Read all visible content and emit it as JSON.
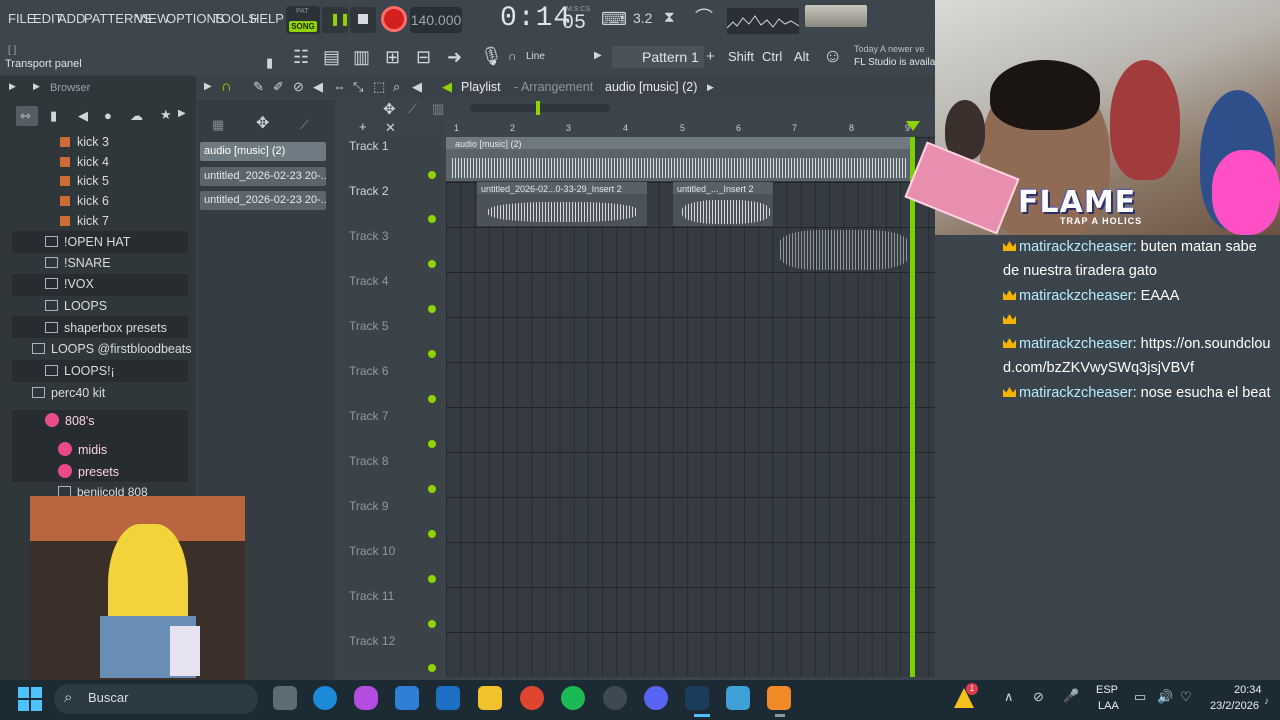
{
  "menu": [
    "FILE",
    "EDIT",
    "ADD",
    "PATTERNS",
    "VIEW",
    "OPTIONS",
    "TOOLS",
    "HELP"
  ],
  "transport": {
    "mode_pat": "PAT",
    "mode_song": "SONG",
    "tempo": "140.000",
    "time_main": "0:14",
    "time_sub": "05",
    "time_unit": "M:S:CS"
  },
  "toolbar": {
    "hint_mark": "[ ]",
    "hint": "Transport panel",
    "line": "Line",
    "pattern": "Pattern 1",
    "shift": "Shift",
    "ctrl": "Ctrl",
    "alt": "Alt",
    "news_1": "Today  A newer ve",
    "news_2": "FL Studio is availa"
  },
  "browser": {
    "title": "Browser",
    "kicks": [
      "kick 3",
      "kick 4",
      "kick 5",
      "kick 6",
      "kick 7"
    ],
    "folders": [
      "!OPEN HAT",
      "!SNARE",
      "!VOX",
      "LOOPS",
      "shaperbox presets"
    ],
    "root_folders": [
      "LOOPS @firstbloodbeats"
    ],
    "loops_sub": "LOOPS!¡",
    "kit": "perc40 kit",
    "pink_folders": [
      "808's",
      "midis",
      "presets"
    ],
    "beniicold": "beniicold 808"
  },
  "channels": [
    "audio [music] (2)",
    "untitled_2026-02-23 20-...",
    "untitled_2026-02-23 20-..."
  ],
  "playlist": {
    "title": "Playlist",
    "sub": "- Arrangement",
    "clip": "audio [music] (2)",
    "ruler": [
      "1",
      "2",
      "3",
      "4",
      "5",
      "6",
      "7",
      "8",
      "9"
    ],
    "tracks": [
      "Track 1",
      "Track 2",
      "Track 3",
      "Track 4",
      "Track 5",
      "Track 6",
      "Track 7",
      "Track 8",
      "Track 9",
      "Track 10",
      "Track 11",
      "Track 12"
    ],
    "clip_labels": [
      "audio [music] (2)",
      "untitled_2026-02...0-33-29_Insert 2",
      "untitled_..._Insert 2"
    ]
  },
  "overlay": {
    "flame": "FLAME",
    "flame_sub": "TRAP A HOLICS"
  },
  "chat": [
    {
      "user": "matirackzcheaser",
      "msg": ": buten matan sabe de nuestra tiradera gato"
    },
    {
      "user": "matirackzcheaser",
      "msg": ": EAAA"
    },
    {
      "user": "",
      "msg": ""
    },
    {
      "user": "matirackzcheaser",
      "msg": ": https://on.soundcloud.com/bzZKVwySWq3jsjVBVf"
    },
    {
      "user": "matirackzcheaser",
      "msg": ": nose esucha el beat"
    }
  ],
  "taskbar": {
    "search": "Buscar",
    "lang_1": "ESP",
    "lang_2": "LAA",
    "time": "20:34",
    "date": "23/2/2026",
    "notif_count": "1"
  },
  "colors": {
    "accent": "#8fd400",
    "record": "#d41f1f",
    "chat_user": "#b9ecff"
  }
}
